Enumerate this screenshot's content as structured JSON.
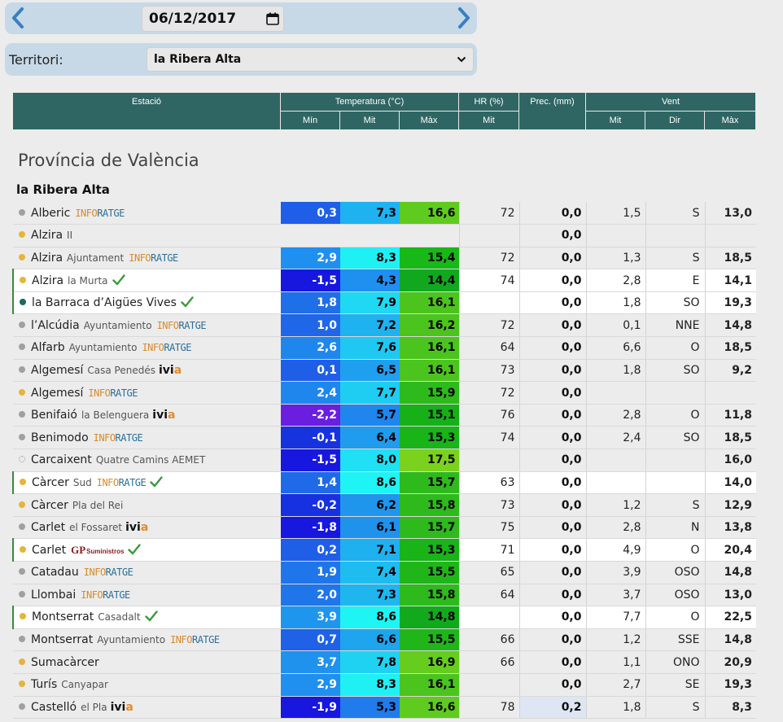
{
  "date": "06/12/2017",
  "territori_label": "Territori:",
  "territori_value": "la Ribera Alta",
  "headers": {
    "estacio": "Estació",
    "temperatura": "Temperatura (°C)",
    "hr": "HR (%)",
    "prec": "Prec. (mm)",
    "vent": "Vent",
    "min": "Mín",
    "mit": "Mit",
    "max": "Màx",
    "hr_mit": "Mit",
    "vent_mit": "Mit",
    "vent_dir": "Dir",
    "vent_max": "Màx"
  },
  "province": "Província de València",
  "comarca": "la Ribera Alta",
  "rows": [
    {
      "name": "Alberic",
      "sub": "",
      "logo": "inforatge",
      "dot": "#a0a0a0",
      "check": false,
      "hl": false,
      "min": "0,3",
      "mit": "7,3",
      "max": "16,6",
      "hr": "72",
      "prec": "0,0",
      "vmit": "1,5",
      "vdir": "S",
      "vmax": "13,0",
      "cmin": "#1f5fe8",
      "cmit": "#1fb2f0",
      "cmax": "#5ecb1e"
    },
    {
      "name": "Alzira",
      "sub": "II",
      "logo": "",
      "dot": "#e6b43c",
      "check": false,
      "hl": false,
      "min": "",
      "mit": "",
      "max": "",
      "hr": "",
      "prec": "0,0",
      "vmit": "",
      "vdir": "",
      "vmax": "",
      "cmin": "",
      "cmit": "",
      "cmax": ""
    },
    {
      "name": "Alzira",
      "sub": "Ajuntament",
      "logo": "inforatge",
      "dot": "#e6b43c",
      "check": false,
      "hl": false,
      "min": "2,9",
      "mit": "8,3",
      "max": "15,4",
      "hr": "72",
      "prec": "0,0",
      "vmit": "1,3",
      "vdir": "S",
      "vmax": "18,5",
      "cmin": "#1f8ff0",
      "cmit": "#1ff0f4",
      "cmax": "#18b818"
    },
    {
      "name": "Alzira",
      "sub": "la Murta",
      "logo": "",
      "dot": "#e6b43c",
      "check": true,
      "hl": true,
      "min": "-1,5",
      "mit": "4,3",
      "max": "14,4",
      "hr": "74",
      "prec": "0,0",
      "vmit": "2,8",
      "vdir": "E",
      "vmax": "14,1",
      "cmin": "#1717e0",
      "cmit": "#1f8ff0",
      "cmax": "#11a81f"
    },
    {
      "name": "la Barraca d’Aigües Vives",
      "sub": "",
      "logo": "",
      "dot": "#1a6a5e",
      "check": true,
      "hl": true,
      "min": "1,8",
      "mit": "7,9",
      "max": "16,1",
      "hr": "",
      "prec": "0,0",
      "vmit": "1,8",
      "vdir": "SO",
      "vmax": "19,3",
      "cmin": "#1f6fe8",
      "cmit": "#1fd8f2",
      "cmax": "#4cc41e"
    },
    {
      "name": "l’Alcúdia",
      "sub": "Ayuntamiento",
      "logo": "inforatge",
      "dot": "#a0a0a0",
      "check": false,
      "hl": false,
      "min": "1,0",
      "mit": "7,2",
      "max": "16,2",
      "hr": "72",
      "prec": "0,0",
      "vmit": "0,1",
      "vdir": "NNE",
      "vmax": "14,8",
      "cmin": "#1f66e8",
      "cmit": "#1fb2f0",
      "cmax": "#4cc41e"
    },
    {
      "name": "Alfarb",
      "sub": "Ayuntamiento",
      "logo": "inforatge",
      "dot": "#a0a0a0",
      "check": false,
      "hl": false,
      "min": "2,6",
      "mit": "7,6",
      "max": "16,1",
      "hr": "64",
      "prec": "0,0",
      "vmit": "6,6",
      "vdir": "O",
      "vmax": "18,5",
      "cmin": "#1f86ee",
      "cmit": "#1fc8f2",
      "cmax": "#4cc41e"
    },
    {
      "name": "Algemesí",
      "sub": "Casa Penedés",
      "logo": "ivia",
      "dot": "#a0a0a0",
      "check": false,
      "hl": false,
      "min": "0,1",
      "mit": "6,5",
      "max": "16,1",
      "hr": "73",
      "prec": "0,0",
      "vmit": "1,8",
      "vdir": "SO",
      "vmax": "9,2",
      "cmin": "#1f5fe8",
      "cmit": "#1fa0ee",
      "cmax": "#4cc41e"
    },
    {
      "name": "Algemesí",
      "sub": "",
      "logo": "inforatge",
      "dot": "#e6b43c",
      "check": false,
      "hl": false,
      "min": "2,4",
      "mit": "7,7",
      "max": "15,9",
      "hr": "72",
      "prec": "0,0",
      "vmit": "",
      "vdir": "",
      "vmax": "",
      "cmin": "#1f86ee",
      "cmit": "#1fccf2",
      "cmax": "#2eba1c"
    },
    {
      "name": "Benifaió",
      "sub": "la Belenguera",
      "logo": "ivia",
      "dot": "#a0a0a0",
      "check": false,
      "hl": false,
      "min": "-2,2",
      "mit": "5,7",
      "max": "15,1",
      "hr": "76",
      "prec": "0,0",
      "vmit": "2,8",
      "vdir": "O",
      "vmax": "11,8",
      "cmin": "#6a1fe0",
      "cmit": "#1f86ee",
      "cmax": "#18b018"
    },
    {
      "name": "Benimodo",
      "sub": "",
      "logo": "inforatge",
      "dot": "#a0a0a0",
      "check": false,
      "hl": false,
      "min": "-0,1",
      "mit": "6,4",
      "max": "15,3",
      "hr": "74",
      "prec": "0,0",
      "vmit": "2,4",
      "vdir": "SO",
      "vmax": "18,5",
      "cmin": "#1733e0",
      "cmit": "#1f9ced",
      "cmax": "#18b418"
    },
    {
      "name": "Carcaixent",
      "sub": "Quatre Camins AEMET",
      "logo": "",
      "dot": "ring",
      "check": false,
      "hl": false,
      "min": "-1,5",
      "mit": "8,0",
      "max": "17,5",
      "hr": "",
      "prec": "0,0",
      "vmit": "",
      "vdir": "",
      "vmax": "16,0",
      "cmin": "#1717e0",
      "cmit": "#1fe0f4",
      "cmax": "#7ad21e"
    },
    {
      "name": "Càrcer",
      "sub": "Sud",
      "logo": "inforatge",
      "dot": "#e6b43c",
      "check": true,
      "hl": true,
      "min": "1,4",
      "mit": "8,6",
      "max": "15,7",
      "hr": "63",
      "prec": "0,0",
      "vmit": "",
      "vdir": "",
      "vmax": "14,0",
      "cmin": "#1f6ae8",
      "cmit": "#1ff4f4",
      "cmax": "#2eba1c"
    },
    {
      "name": "Càrcer",
      "sub": "Pla del Rei",
      "logo": "",
      "dot": "#e6b43c",
      "check": false,
      "hl": false,
      "min": "-0,2",
      "mit": "6,2",
      "max": "15,8",
      "hr": "73",
      "prec": "0,0",
      "vmit": "1,2",
      "vdir": "S",
      "vmax": "12,9",
      "cmin": "#1730e0",
      "cmit": "#1f96ec",
      "cmax": "#2eba1c"
    },
    {
      "name": "Carlet",
      "sub": "el Fossaret",
      "logo": "ivia",
      "dot": "#a0a0a0",
      "check": false,
      "hl": false,
      "min": "-1,8",
      "mit": "6,1",
      "max": "15,7",
      "hr": "75",
      "prec": "0,0",
      "vmit": "2,8",
      "vdir": "N",
      "vmax": "13,8",
      "cmin": "#1717e0",
      "cmit": "#1f92ec",
      "cmax": "#2eba1c"
    },
    {
      "name": "Carlet",
      "sub": "",
      "logo": "gp",
      "dot": "#e6b43c",
      "check": true,
      "hl": true,
      "min": "0,2",
      "mit": "7,1",
      "max": "15,3",
      "hr": "71",
      "prec": "0,0",
      "vmit": "4,9",
      "vdir": "O",
      "vmax": "20,4",
      "cmin": "#1f5fe8",
      "cmit": "#1fb0f0",
      "cmax": "#18b418"
    },
    {
      "name": "Catadau",
      "sub": "",
      "logo": "inforatge",
      "dot": "#a0a0a0",
      "check": false,
      "hl": false,
      "min": "1,9",
      "mit": "7,4",
      "max": "15,5",
      "hr": "65",
      "prec": "0,0",
      "vmit": "3,9",
      "vdir": "OSO",
      "vmax": "14,8",
      "cmin": "#1f76ea",
      "cmit": "#1fbcf0",
      "cmax": "#20b61a"
    },
    {
      "name": "Llombai",
      "sub": "",
      "logo": "inforatge",
      "dot": "#a0a0a0",
      "check": false,
      "hl": false,
      "min": "2,0",
      "mit": "7,3",
      "max": "15,8",
      "hr": "64",
      "prec": "0,0",
      "vmit": "3,7",
      "vdir": "OSO",
      "vmax": "13,0",
      "cmin": "#1f76ea",
      "cmit": "#1fb6f0",
      "cmax": "#2eba1c"
    },
    {
      "name": "Montserrat",
      "sub": "Casadalt",
      "logo": "",
      "dot": "#e6b43c",
      "check": true,
      "hl": true,
      "min": "3,9",
      "mit": "8,6",
      "max": "14,8",
      "hr": "",
      "prec": "0,0",
      "vmit": "7,7",
      "vdir": "O",
      "vmax": "22,5",
      "cmin": "#1f96ee",
      "cmit": "#1ff4f4",
      "cmax": "#11aa1c"
    },
    {
      "name": "Montserrat",
      "sub": "Ayuntamiento",
      "logo": "inforatge",
      "dot": "#a0a0a0",
      "check": false,
      "hl": false,
      "min": "0,7",
      "mit": "6,6",
      "max": "15,5",
      "hr": "66",
      "prec": "0,0",
      "vmit": "1,2",
      "vdir": "SSE",
      "vmax": "14,8",
      "cmin": "#1f62e8",
      "cmit": "#1fa4ee",
      "cmax": "#20b61a"
    },
    {
      "name": "Sumacàrcer",
      "sub": "",
      "logo": "",
      "dot": "#e6b43c",
      "check": false,
      "hl": false,
      "min": "3,7",
      "mit": "7,8",
      "max": "16,9",
      "hr": "66",
      "prec": "0,0",
      "vmit": "1,1",
      "vdir": "ONO",
      "vmax": "20,9",
      "cmin": "#1f92ee",
      "cmit": "#1fd2f2",
      "cmax": "#66cc1e"
    },
    {
      "name": "Turís",
      "sub": "Canyapar",
      "logo": "",
      "dot": "#e6b43c",
      "check": false,
      "hl": false,
      "min": "2,9",
      "mit": "8,3",
      "max": "16,1",
      "hr": "",
      "prec": "0,0",
      "vmit": "2,7",
      "vdir": "SE",
      "vmax": "19,3",
      "cmin": "#1f8ff0",
      "cmit": "#1ff0f4",
      "cmax": "#4cc41e"
    },
    {
      "name": "Castelló",
      "sub": "el Pla",
      "logo": "ivia",
      "dot": "#a0a0a0",
      "check": false,
      "hl": false,
      "min": "-1,9",
      "mit": "5,3",
      "max": "16,6",
      "hr": "78",
      "prec": "0,2",
      "vmit": "1,8",
      "vdir": "S",
      "vmax": "8,3",
      "cmin": "#1717e0",
      "cmit": "#1f7cea",
      "cmax": "#5ecb1e",
      "precbg": "#dde6f2"
    }
  ]
}
